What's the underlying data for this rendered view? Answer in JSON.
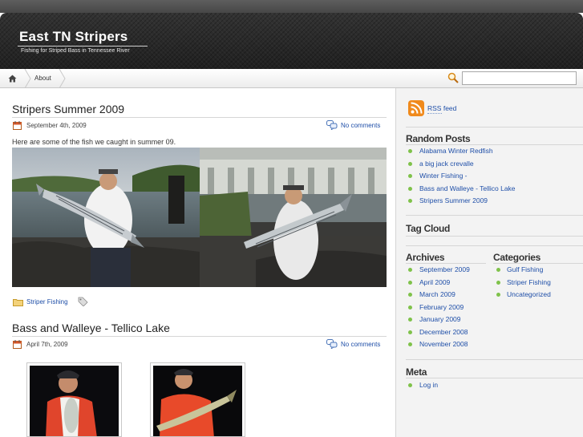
{
  "site": {
    "title": "East TN Stripers",
    "description": "Fishing for Striped Bass in Tennessee River"
  },
  "nav": {
    "home_icon": "home-icon",
    "items": [
      {
        "label": "About"
      }
    ]
  },
  "search": {
    "value": "",
    "placeholder": "",
    "icon": "magnifier-icon"
  },
  "posts": [
    {
      "title": "Stripers Summer 2009",
      "date": "September 4th, 2009",
      "comments": "No comments",
      "excerpt": "Here are some of the fish we caught in summer 09.",
      "category": "Striper Fishing",
      "tag_icon": "tag-icon"
    },
    {
      "title": "Bass and Walleye - Tellico Lake",
      "date": "April 7th, 2009",
      "comments": "No comments"
    }
  ],
  "sidebar": {
    "rss_label": "RSS feed",
    "random_posts": {
      "heading": "Random Posts",
      "items": [
        "Alabama Winter Redfish",
        "a big jack crevalle",
        "Winter Fishing -",
        "Bass and Walleye - Tellico Lake",
        "Stripers Summer 2009"
      ]
    },
    "tag_cloud": {
      "heading": "Tag Cloud"
    },
    "archives": {
      "heading": "Archives",
      "items": [
        "September 2009",
        "April 2009",
        "March 2009",
        "February 2009",
        "January 2009",
        "December 2008",
        "November 2008"
      ]
    },
    "categories": {
      "heading": "Categories",
      "items": [
        "Gulf Fishing",
        "Striper Fishing",
        "Uncategorized"
      ]
    },
    "meta": {
      "heading": "Meta",
      "items": [
        "Log in"
      ]
    }
  },
  "colors": {
    "link": "#1f4fa8",
    "bullet": "#7fc24a",
    "header_bg": "#2a2a2a",
    "rss_orange": "#f08a1c"
  }
}
